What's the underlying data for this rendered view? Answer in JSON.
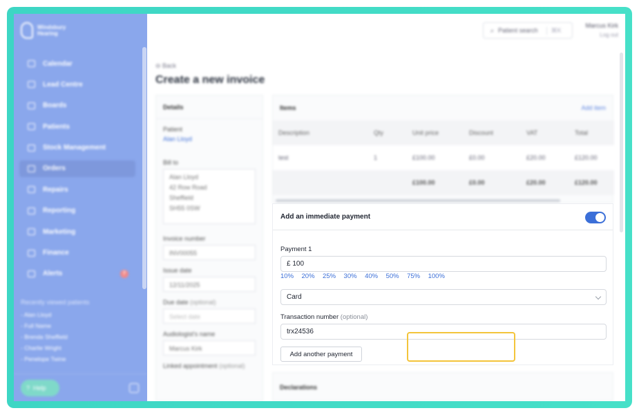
{
  "brand": {
    "name_line1": "Windsbury",
    "name_line2": "Hearing"
  },
  "sidebar": {
    "items": [
      {
        "label": "Calendar",
        "icon": "calendar-icon"
      },
      {
        "label": "Lead Centre",
        "icon": "headset-icon"
      },
      {
        "label": "Boards",
        "icon": "board-icon"
      },
      {
        "label": "Patients",
        "icon": "patient-icon"
      },
      {
        "label": "Stock Management",
        "icon": "stock-icon"
      },
      {
        "label": "Orders",
        "icon": "orders-icon",
        "active": true
      },
      {
        "label": "Repairs",
        "icon": "wrench-icon"
      },
      {
        "label": "Reporting",
        "icon": "chart-icon"
      },
      {
        "label": "Marketing",
        "icon": "mail-icon"
      },
      {
        "label": "Finance",
        "icon": "card-icon"
      },
      {
        "label": "Alerts",
        "icon": "bell-icon",
        "badge": "7"
      }
    ],
    "recent_title": "Recently viewed patients",
    "recent": [
      "- Alan Lloyd",
      "- Full Name",
      "- Brenda Sheffield",
      "- Charlie Wright",
      "- Penelope Twine"
    ],
    "help_label": "Help"
  },
  "topbar": {
    "search_placeholder": "Patient search",
    "search_shortcut": "⌘K",
    "user_name": "Marcus Kirk",
    "logout": "Log out"
  },
  "page": {
    "back": "Back",
    "title": "Create a new invoice"
  },
  "details": {
    "header": "Details",
    "patient_label": "Patient",
    "patient_value": "Alan Lloyd",
    "bill_to_label": "Bill to",
    "bill_to": [
      "Alan Lloyd",
      "42 Row Road",
      "Sheffield",
      "SH55 0SW"
    ],
    "invoice_number_label": "Invoice number",
    "invoice_number": "INV00055",
    "issue_date_label": "Issue date",
    "issue_date": "12/11/2025",
    "due_date_label": "Due date",
    "due_date_optional": "(optional)",
    "due_date_placeholder": "Select date",
    "audiologist_label": "Audiologist's name",
    "audiologist": "Marcus Kirk",
    "linked_label": "Linked appointment",
    "linked_optional": "(optional)"
  },
  "items": {
    "header": "Items",
    "add_item": "Add item",
    "columns": [
      "Description",
      "Qty",
      "Unit price",
      "Discount",
      "VAT",
      "Total"
    ],
    "row": [
      "test",
      "1",
      "£100.00",
      "£0.00",
      "£20.00",
      "£120.00"
    ],
    "totals": [
      "£100.00",
      "£0.00",
      "£20.00",
      "£120.00"
    ]
  },
  "payment": {
    "header": "Add an immediate payment",
    "toggle_on": true,
    "payment_label": "Payment 1",
    "amount": "£ 100",
    "percentages": [
      "10%",
      "20%",
      "25%",
      "30%",
      "40%",
      "50%",
      "75%",
      "100%"
    ],
    "method": "Card",
    "transaction_label": "Transaction number",
    "transaction_optional": "(optional)",
    "transaction_value": "trx24536",
    "add_another": "Add another payment"
  },
  "declarations": {
    "header": "Declarations"
  },
  "colors": {
    "accent": "#3b6fd8",
    "sidebar": "#8aa7ec",
    "frame": "#3dd6c4",
    "highlight": "#f3c43a"
  }
}
